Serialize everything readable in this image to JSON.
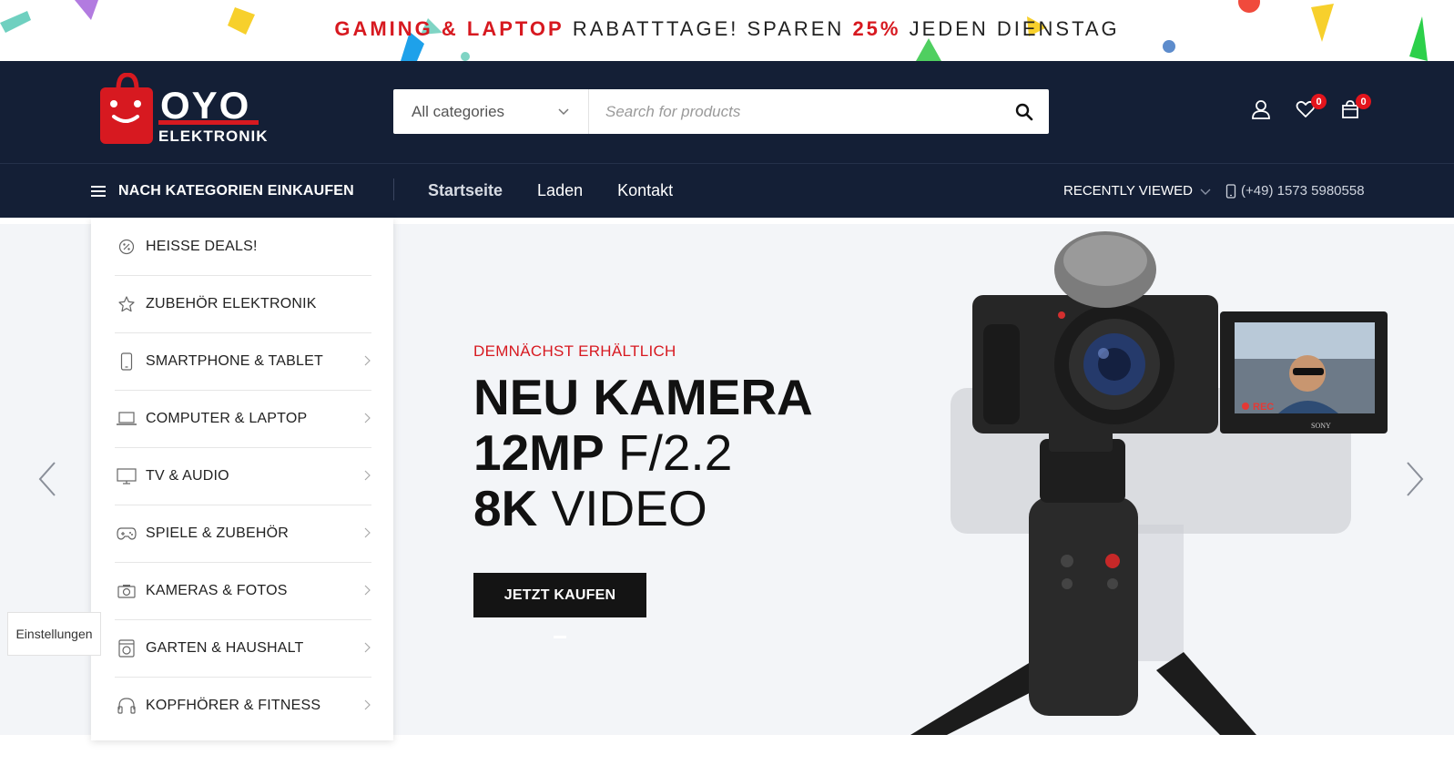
{
  "promo": {
    "part1": "GAMING & LAPTOP",
    "part2": " RABATTTAGE! SPAREN ",
    "part3": "25%",
    "part4": " JEDEN DIENSTAG"
  },
  "header": {
    "logo_line1": "OYO",
    "logo_line2": "ELEKTRONIK",
    "category_select": "All categories",
    "search_placeholder": "Search for products",
    "wishlist_count": "0",
    "cart_count": "0"
  },
  "nav": {
    "browse_label": "NACH KATEGORIEN EINKAUFEN",
    "links": [
      "Startseite",
      "Laden",
      "Kontakt"
    ],
    "recently_viewed": "RECENTLY VIEWED",
    "phone": "(+49) 1573 5980558"
  },
  "categories": [
    {
      "label": "HEISSE DEALS!",
      "icon": "discount-tag-icon",
      "has_submenu": false
    },
    {
      "label": "ZUBEHÖR ELEKTRONIK",
      "icon": "star-icon",
      "has_submenu": false
    },
    {
      "label": "SMARTPHONE & TABLET",
      "icon": "smartphone-icon",
      "has_submenu": true
    },
    {
      "label": "COMPUTER & LAPTOP",
      "icon": "laptop-icon",
      "has_submenu": true
    },
    {
      "label": "TV & AUDIO",
      "icon": "monitor-icon",
      "has_submenu": true
    },
    {
      "label": "SPIELE & ZUBEHÖR",
      "icon": "gamepad-icon",
      "has_submenu": true
    },
    {
      "label": "KAMERAS & FOTOS",
      "icon": "camera-icon",
      "has_submenu": true
    },
    {
      "label": "GARTEN & HAUSHALT",
      "icon": "washing-machine-icon",
      "has_submenu": true
    },
    {
      "label": "KOPFHÖRER & FITNESS",
      "icon": "headphones-icon",
      "has_submenu": true
    }
  ],
  "hero": {
    "eyebrow": "DEMNÄCHST ERHÄLTLICH",
    "line1": "NEU KAMERA",
    "line2_bold": "12MP",
    "line2_thin": " F/2.2",
    "line3_bold": "8K",
    "line3_thin": " VIDEO",
    "cta": "JETZT KAUFEN",
    "camera_brand": "SONY",
    "rec_label": "REC"
  },
  "settings_label": "Einstellungen",
  "colors": {
    "header_bg": "#141f36",
    "accent_red": "#d71920",
    "hero_bg": "#f3f5f8"
  }
}
